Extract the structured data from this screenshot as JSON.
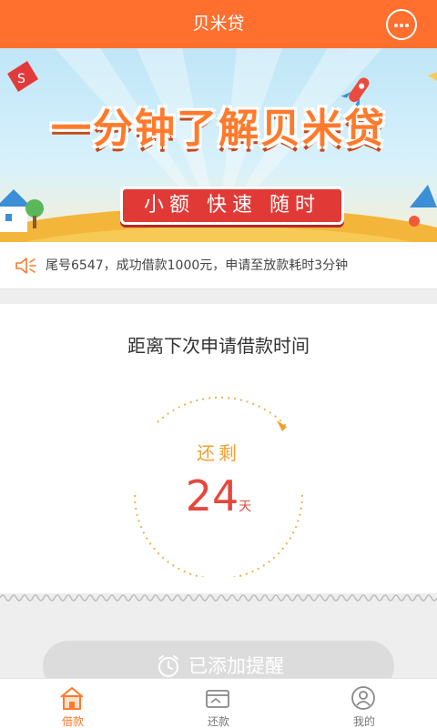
{
  "header": {
    "title": "贝米贷"
  },
  "banner": {
    "title": "一分钟了解贝米贷",
    "subtitle": "小额 快速 随时"
  },
  "notice": {
    "text": "尾号6547，成功借款1000元，申请至放款耗时3分钟"
  },
  "countdown": {
    "title": "距离下次申请借款时间",
    "remain_label": "还剩",
    "days": "24",
    "unit": "天"
  },
  "reminder": {
    "label": "已添加提醒"
  },
  "tabs": [
    {
      "label": "借款",
      "icon": "home-icon",
      "active": true
    },
    {
      "label": "还款",
      "icon": "card-icon",
      "active": false
    },
    {
      "label": "我的",
      "icon": "user-icon",
      "active": false
    }
  ],
  "colors": {
    "primary": "#ff6f2e",
    "accent_red": "#e5483e",
    "accent_yellow": "#f0a030"
  }
}
